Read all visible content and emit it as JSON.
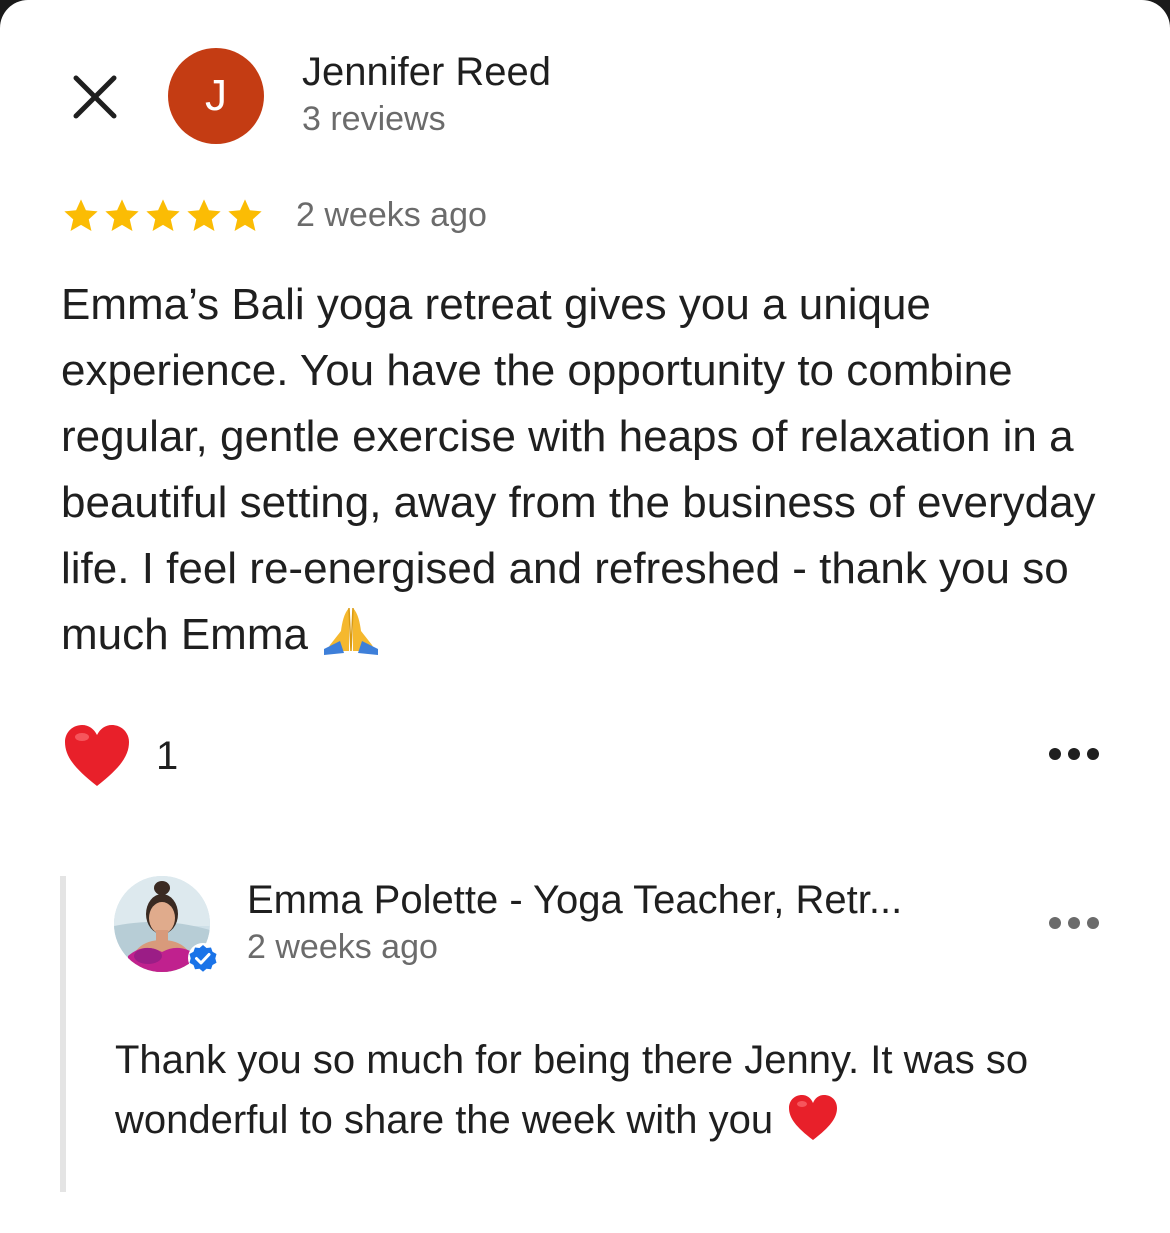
{
  "reviewer": {
    "avatar_letter": "J",
    "name": "Jennifer Reed",
    "meta": "3 reviews"
  },
  "review": {
    "rating": 5,
    "rating_max": 5,
    "star_color": "#fbbc04",
    "time": "2 weeks ago",
    "text": "Emma’s Bali yoga retreat gives you a unique experience. You have the opportunity to combine regular, gentle exercise with heaps of relaxation in a beautiful setting,  away from the business of everyday life. I feel re-energised and refreshed - thank you so much Emma",
    "emoji": "folded-hands-icon"
  },
  "reactions": {
    "heart_count": "1",
    "heart_color": "#e8202a"
  },
  "reply": {
    "owner_name": "Emma Polette - Yoga Teacher, Retr...",
    "time": "2 weeks ago",
    "text": "Thank you so much for being there Jenny. It was so wonderful to share the week with you",
    "emoji": "red-heart-icon",
    "verified_badge_color": "#1a73e8"
  },
  "icons": {
    "close": "close-icon",
    "more": "more-options-icon",
    "avatar_letter_color": "#c43c13"
  }
}
